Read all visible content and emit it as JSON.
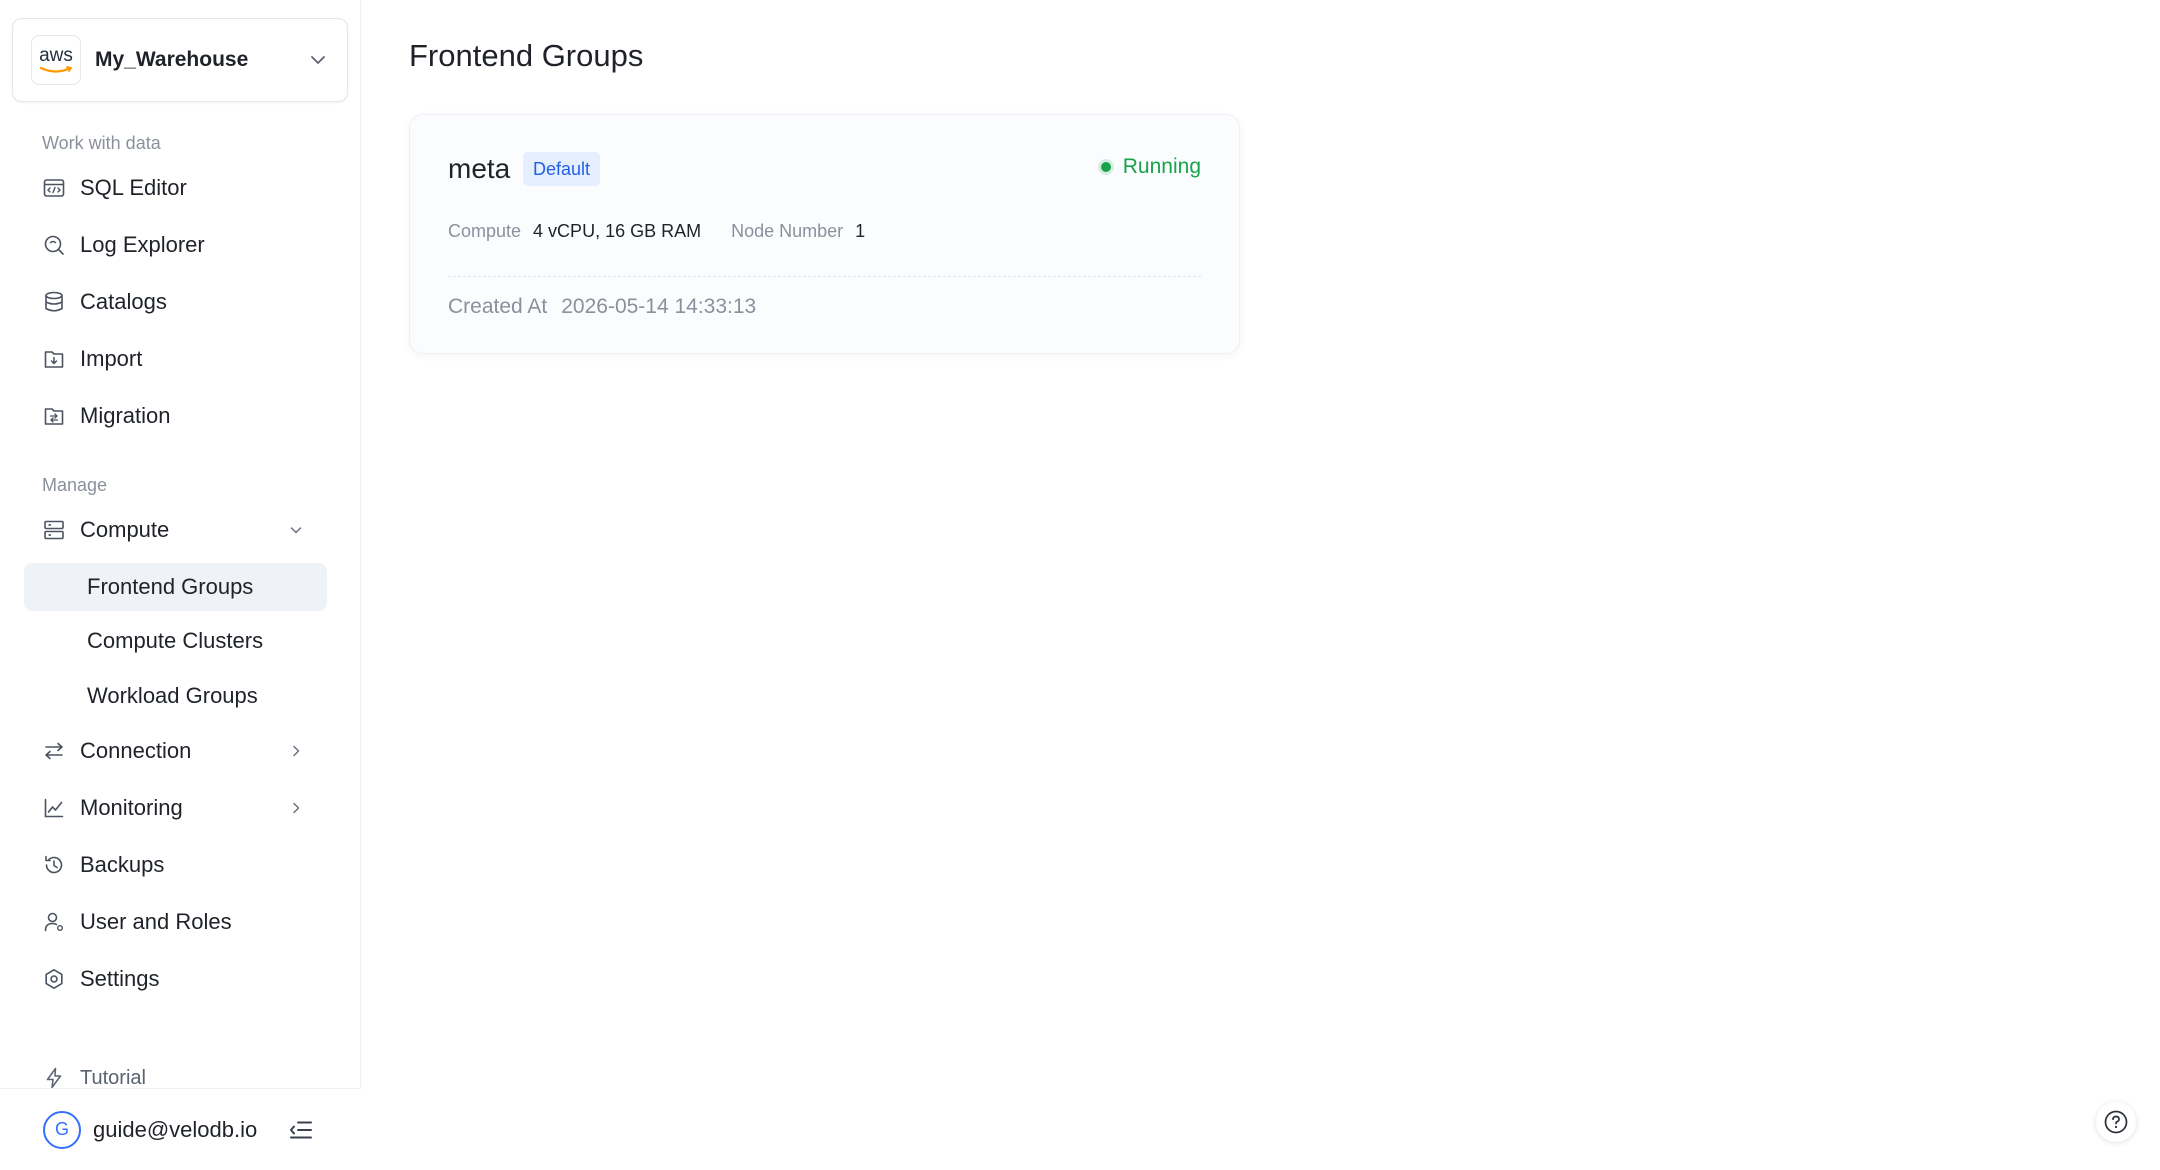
{
  "workspace": {
    "provider_logo_text": "aws",
    "name": "My_Warehouse"
  },
  "sidebar": {
    "section_work": "Work with data",
    "section_manage": "Manage",
    "items": {
      "sql_editor": "SQL Editor",
      "log_explorer": "Log Explorer",
      "catalogs": "Catalogs",
      "import": "Import",
      "migration": "Migration",
      "compute": "Compute",
      "frontend_groups": "Frontend Groups",
      "compute_clusters": "Compute Clusters",
      "workload_groups": "Workload Groups",
      "connection": "Connection",
      "monitoring": "Monitoring",
      "backups": "Backups",
      "user_and_roles": "User and Roles",
      "settings": "Settings"
    },
    "active_item": "Frontend Groups",
    "tutorial": "Tutorial"
  },
  "user": {
    "avatar_initial": "G",
    "email": "guide@velodb.io"
  },
  "page": {
    "title": "Frontend Groups"
  },
  "frontend_group": {
    "name": "meta",
    "badge": "Default",
    "status": "Running",
    "status_color": "#17a34a",
    "compute_label": "Compute",
    "compute_value": "4 vCPU, 16 GB RAM",
    "node_label": "Node Number",
    "node_value": "1",
    "created_label": "Created At",
    "created_value": "2026-05-14 14:33:13"
  },
  "colors": {
    "accent": "#3370ff",
    "active_bg": "#eff2f7",
    "badge_bg": "#e6efff",
    "badge_text": "#2160e6"
  },
  "icons": {
    "help": "help-circle-icon"
  }
}
